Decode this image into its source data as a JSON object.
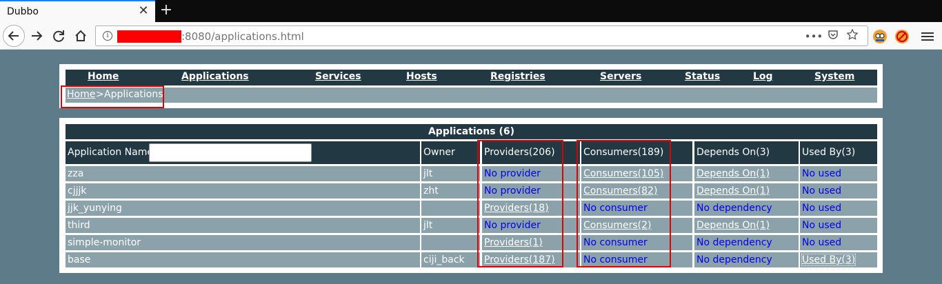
{
  "browser": {
    "tab_title": "Dubbo",
    "tab_close": "✕",
    "new_tab": "+",
    "url_suffix": ":8080/applications.html",
    "info_icon": "i",
    "actions": [
      "•••",
      "pocket-icon",
      "star-icon"
    ]
  },
  "nav": {
    "items": [
      "Home",
      "Applications",
      "Services",
      "Hosts",
      "Registries",
      "Servers",
      "Status",
      "Log",
      "System"
    ]
  },
  "breadcrumb": {
    "home": "Home",
    "separator": ">",
    "current": "Applications"
  },
  "table": {
    "title": "Applications (6)",
    "headers": {
      "app_name": "Application Name:",
      "owner": "Owner",
      "providers": "Providers(206)",
      "consumers": "Consumers(189)",
      "depends": "Depends On(3)",
      "used_by": "Used By(3)"
    },
    "search_value": "",
    "rows": [
      {
        "name": "zza",
        "owner": "jlt",
        "providers": "No provider",
        "consumers": "Consumers(105)",
        "depends": "Depends On(1)",
        "used_by": "No used"
      },
      {
        "name": "cjjjk",
        "owner": "zht",
        "providers": "No provider",
        "consumers": "Consumers(82)",
        "depends": "Depends On(1)",
        "used_by": "No used"
      },
      {
        "name": "jjk_yunying",
        "owner": "",
        "providers": "Providers(18)",
        "consumers": "No consumer",
        "depends": "No dependency",
        "used_by": "No used"
      },
      {
        "name": "third",
        "owner": "jlt",
        "providers": "No provider",
        "consumers": "Consumers(2)",
        "depends": "Depends On(1)",
        "used_by": "No used"
      },
      {
        "name": "simple-monitor",
        "owner": "",
        "providers": "Providers(1)",
        "consumers": "No consumer",
        "depends": "No dependency",
        "used_by": "No used"
      },
      {
        "name": "base",
        "owner": "ciji_back",
        "providers": "Providers(187)",
        "consumers": "No consumer",
        "depends": "No dependency",
        "used_by": "Used By(3)"
      }
    ]
  },
  "colors": {
    "header_bg": "#223843",
    "row_bg": "#8ca2ab",
    "page_bg": "#5d7b88",
    "link_blue": "#0000ee",
    "highlight": "#e00000"
  }
}
